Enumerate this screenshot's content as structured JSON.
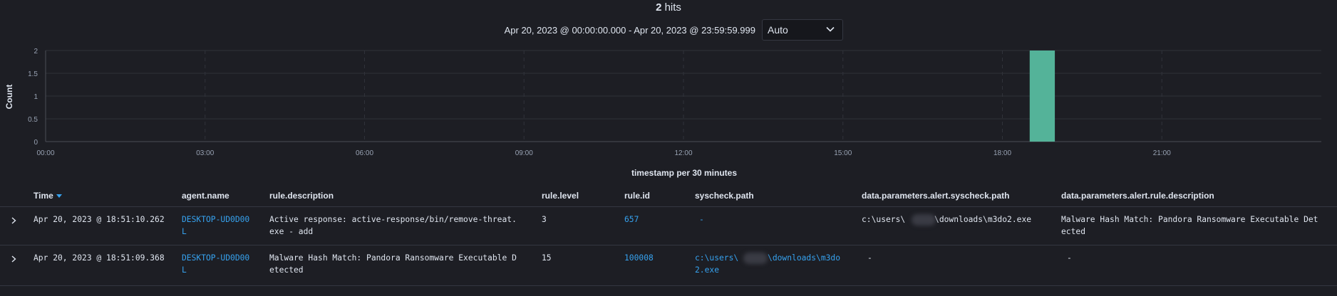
{
  "summary": {
    "hits_count": "2",
    "hits_label": "hits"
  },
  "time_range": {
    "text": "Apr 20, 2023 @ 00:00:00.000 - Apr 20, 2023 @ 23:59:59.999",
    "interval": "Auto"
  },
  "chart_data": {
    "type": "bar",
    "ylabel": "Count",
    "xlabel": "timestamp per 30 minutes",
    "x_range": [
      0,
      24
    ],
    "x_ticks": [
      "00:00",
      "03:00",
      "06:00",
      "09:00",
      "12:00",
      "15:00",
      "18:00",
      "21:00"
    ],
    "ylim": [
      0,
      2
    ],
    "y_ticks": [
      "0",
      "0.5",
      "1",
      "1.5",
      "2"
    ],
    "bars": [
      {
        "x": "18:30",
        "value": 2
      }
    ],
    "bar_color": "#54b399",
    "grid": true
  },
  "table": {
    "columns": [
      "Time",
      "agent.name",
      "rule.description",
      "rule.level",
      "rule.id",
      "syscheck.path",
      "data.parameters.alert.syscheck.path",
      "data.parameters.alert.rule.description"
    ],
    "rows": [
      {
        "time": "Apr 20, 2023 @ 18:51:10.262",
        "agent": [
          "DESKTOP-UD0D00",
          "L"
        ],
        "description": [
          "Active response: active-response/bin/remove-threat.",
          "exe - add"
        ],
        "level": "3",
        "id": "657",
        "syscheck_path": [
          "-"
        ],
        "alert_syscheck_path": [
          "c:\\users\\      \\downloads\\m3do2.exe"
        ],
        "alert_rule_description": [
          "Malware Hash Match: Pandora Ransomware Executable Det",
          "ected"
        ]
      },
      {
        "time": "Apr 20, 2023 @ 18:51:09.368",
        "agent": [
          "DESKTOP-UD0D00",
          "L"
        ],
        "description": [
          "Malware Hash Match: Pandora Ransomware Executable D",
          "etected"
        ],
        "level": "15",
        "id": "100008",
        "syscheck_path": [
          "c:\\users\\      \\downloads\\m3do",
          "2.exe"
        ],
        "alert_syscheck_path": [
          "-"
        ],
        "alert_rule_description": [
          "-"
        ]
      }
    ]
  },
  "colors": {
    "background": "#1d1e24",
    "link": "#36a2ef",
    "bar": "#54b399",
    "grid": "#343741"
  }
}
